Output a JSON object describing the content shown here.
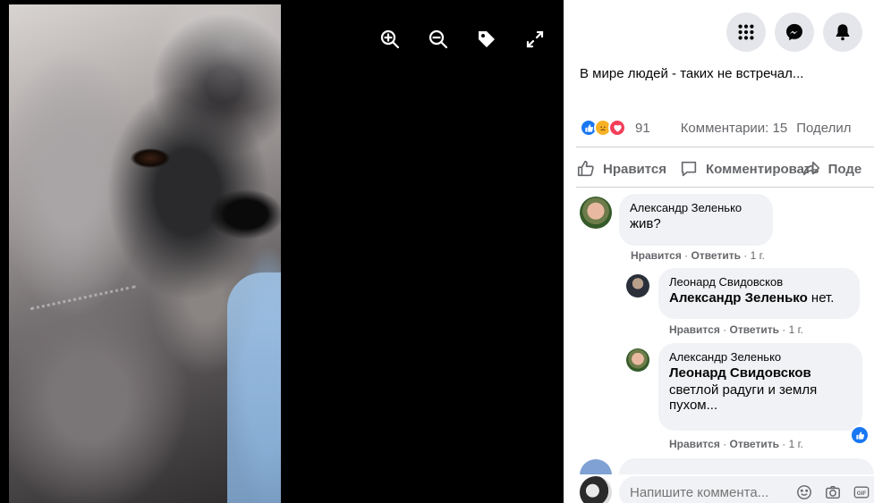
{
  "viewer": {
    "icons": [
      "zoom-in-icon",
      "zoom-out-icon",
      "tag-icon",
      "fullscreen-icon"
    ]
  },
  "topbar": {
    "icons": [
      "menu-grid-icon",
      "messenger-icon",
      "notifications-icon"
    ]
  },
  "post": {
    "caption": "В мире людей - таких не встречал...",
    "reactions_count": "91",
    "comments_count": "Комментарии: 15",
    "shares_label": "Поделил",
    "actions": {
      "like": "Нравится",
      "comment": "Комментировать",
      "share": "Поде"
    }
  },
  "comments": [
    {
      "author": "Александр Зеленько",
      "text": "жив?",
      "meta": {
        "like": "Нравится",
        "reply": "Ответить",
        "time": "1 г."
      }
    },
    {
      "author": "Леонард Свидовсков",
      "mention": "Александр Зеленько",
      "text": " нет.",
      "meta": {
        "like": "Нравится",
        "reply": "Ответить",
        "time": "1 г."
      }
    },
    {
      "author": "Александр Зеленько",
      "mention": "Леонард Свидовсков",
      "text_line1": "светлой радуги и земля",
      "text_line2": "пухом...",
      "meta": {
        "like": "Нравится",
        "reply": "Ответить",
        "time": "1 г."
      }
    }
  ],
  "compose": {
    "placeholder": "Напишите коммента..."
  },
  "colors": {
    "accent": "#1877f2",
    "bubble": "#f0f2f5",
    "secondary_text": "#65676b"
  }
}
